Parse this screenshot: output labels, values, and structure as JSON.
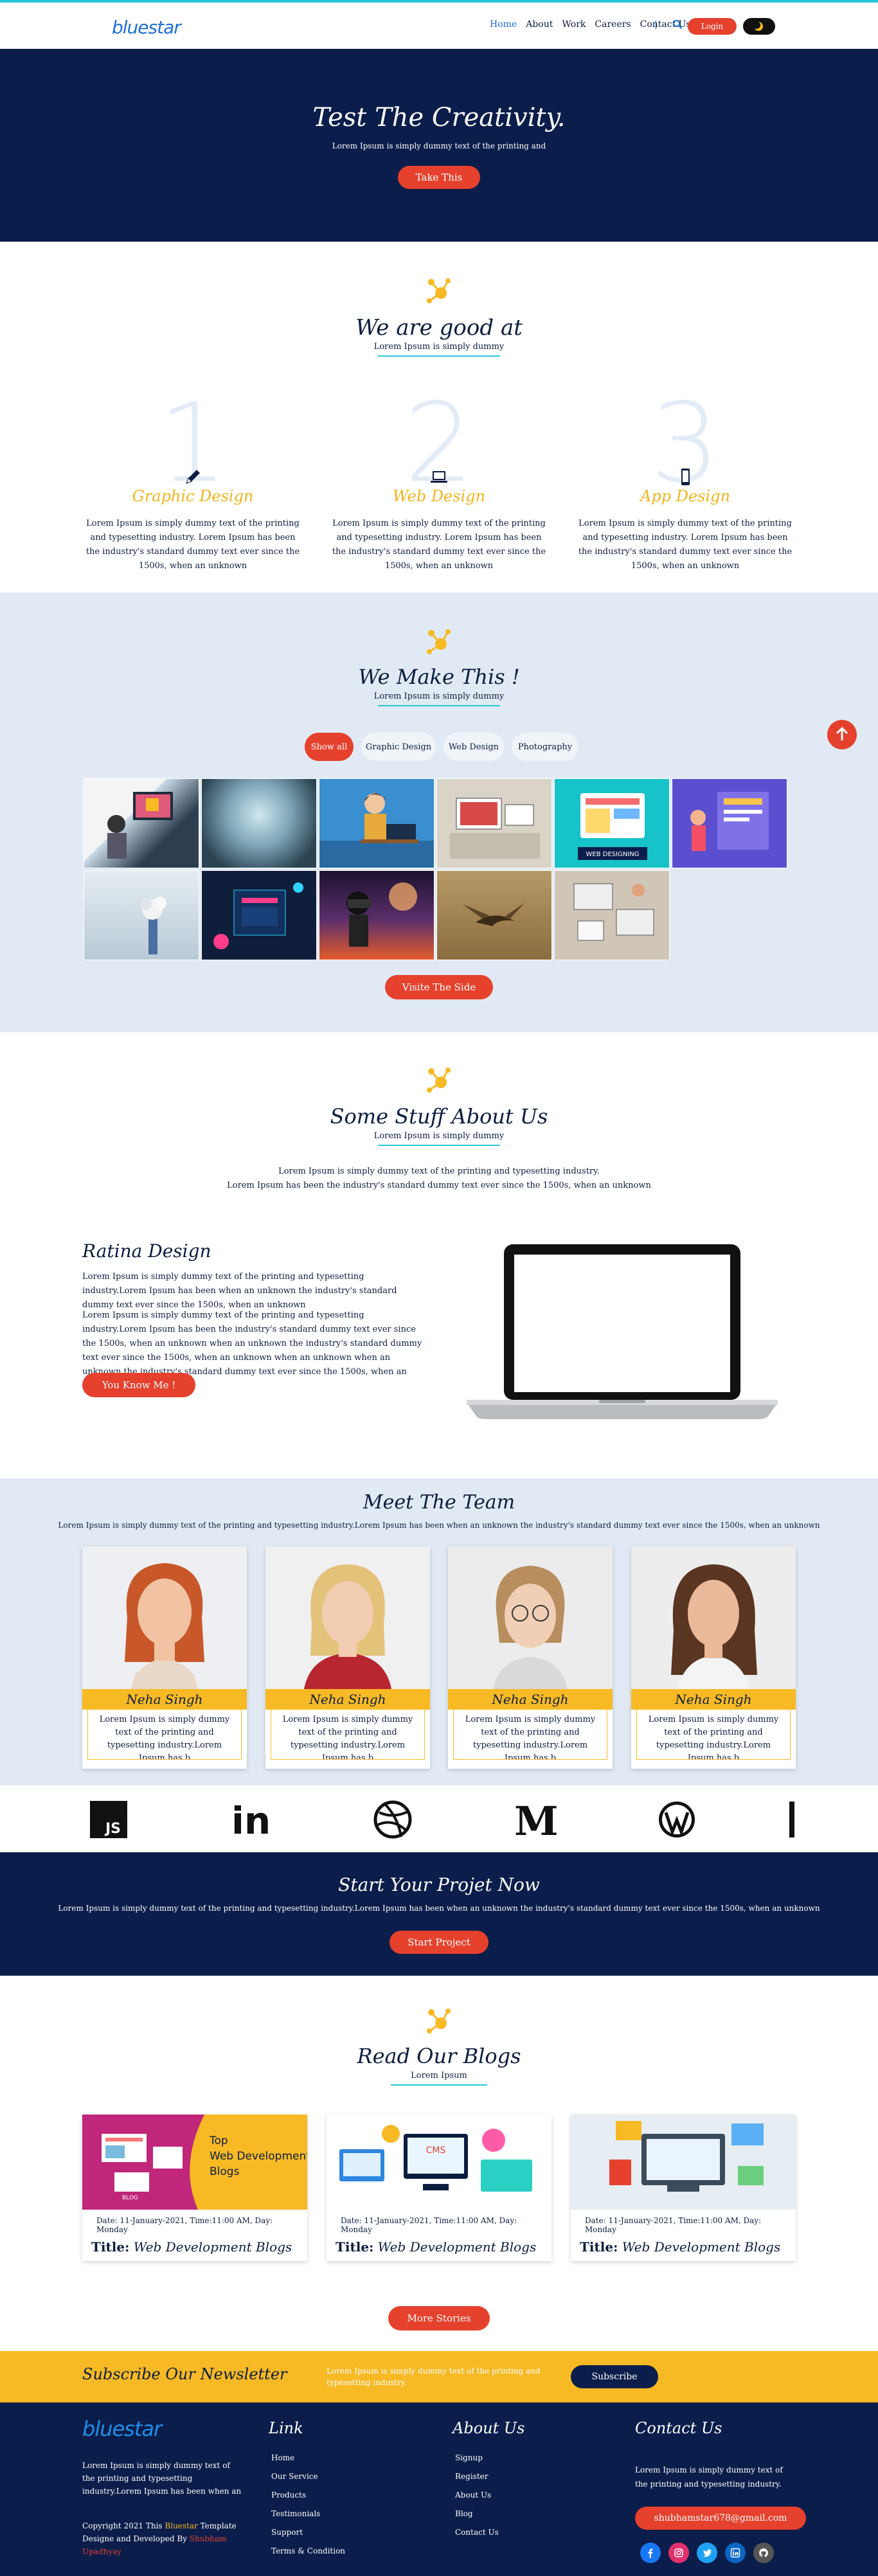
{
  "brand": {
    "logo": "bluestar"
  },
  "nav": {
    "links": [
      "Home",
      "About",
      "Work",
      "Careers",
      "Contact Us"
    ],
    "separator": "|",
    "login": "Login"
  },
  "hero": {
    "title": "Test The Creativity.",
    "subtitle": "Lorem Ipsum is simply dummy text of the printing and",
    "button": "Take This"
  },
  "skills": {
    "title": "We are good at",
    "subtitle": "Lorem Ipsum is simply dummy",
    "items": [
      {
        "num": "1",
        "title": "Graphic Design",
        "icon": "pencil-icon",
        "desc": "Lorem Ipsum is simply dummy text of the printing and typesetting industry. Lorem Ipsum has been the industry's standard dummy text ever since the 1500s, when an unknown"
      },
      {
        "num": "2",
        "title": "Web Design",
        "icon": "laptop-icon",
        "desc": "Lorem Ipsum is simply dummy text of the printing and typesetting industry. Lorem Ipsum has been the industry's standard dummy text ever since the 1500s, when an unknown"
      },
      {
        "num": "3",
        "title": "App Design",
        "icon": "mobile-icon",
        "desc": "Lorem Ipsum is simply dummy text of the printing and typesetting industry. Lorem Ipsum has been the industry's standard dummy text ever since the 1500s, when an unknown"
      }
    ]
  },
  "portfolio": {
    "title": "We Make This !",
    "subtitle": "Lorem Ipsum is simply dummy",
    "filters": [
      "Show all",
      "Graphic Design",
      "Web Design",
      "Photography"
    ],
    "web_designing_label": "WEB DESIGNING",
    "button": "Visite The Side"
  },
  "about": {
    "title": "Some Stuff About Us",
    "subtitle": "Lorem Ipsum is simply dummy",
    "intro1": "Lorem Ipsum is simply dummy text of the printing and typesetting industry.",
    "intro2": "Lorem Ipsum has been the industry's standard dummy text ever since the 1500s, when an unknown",
    "name": "Ratina Design",
    "p1": "Lorem Ipsum is simply dummy text of the printing and typesetting industry.Lorem Ipsum has been when an unknown the industry's standard dummy text ever since the 1500s, when an unknown",
    "p2": "Lorem Ipsum is simply dummy text of the printing and typesetting industry.Lorem Ipsum has been the industry's standard dummy text ever since the 1500s, when an unknown when an unknown the industry's standard dummy text ever since the 1500s, when an unknown when an unknown when an unknown the industry's standard dummy text ever since the 1500s, when an unknown",
    "button": "You Know Me !"
  },
  "team": {
    "title": "Meet The Team",
    "subtitle": "Lorem Ipsum is simply dummy text of the printing and typesetting industry.Lorem Ipsum has been when an unknown the industry's standard dummy text ever since the 1500s, when an unknown",
    "members": [
      {
        "name": "Neha Singh",
        "bio": "Lorem Ipsum is simply dummy text of the printing and typesetting industry.Lorem Ipsum has b"
      },
      {
        "name": "Neha Singh",
        "bio": "Lorem Ipsum is simply dummy text of the printing and typesetting industry.Lorem Ipsum has b"
      },
      {
        "name": "Neha Singh",
        "bio": "Lorem Ipsum is simply dummy text of the printing and typesetting industry.Lorem Ipsum has b"
      },
      {
        "name": "Neha Singh",
        "bio": "Lorem Ipsum is simply dummy text of the printing and typesetting industry.Lorem Ipsum has b"
      }
    ]
  },
  "logos": {
    "js": "JS",
    "linkedin": "in",
    "medium": "M",
    "items": [
      "js-logo-icon",
      "linkedin-logo-icon",
      "dribbble-logo-icon",
      "medium-logo-icon",
      "wordpress-logo-icon"
    ]
  },
  "cta": {
    "title": "Start Your Projet Now",
    "subtitle": "Lorem Ipsum is simply dummy text of the printing and typesetting industry.Lorem Ipsum has been when an unknown the industry's standard dummy text ever since the 1500s, when an unknown",
    "button": "Start Project"
  },
  "blogs": {
    "title": "Read Our Blogs",
    "subtitle": "Lorem Ipsum",
    "banner": {
      "top": "Top",
      "line2": "Web Development",
      "line3": "Blogs",
      "tag": "BLOG"
    },
    "cms_label": "CMS",
    "items": [
      {
        "date": "Date: 11-January-2021, Time:11:00 AM, Day: Monday",
        "title_label": "Title:",
        "title": "Web Development Blogs"
      },
      {
        "date": "Date: 11-January-2021, Time:11:00 AM, Day: Monday",
        "title_label": "Title:",
        "title": "Web Development Blogs"
      },
      {
        "date": "Date: 11-January-2021, Time:11:00 AM, Day: Monday",
        "title_label": "Title:",
        "title": "Web Development Blogs"
      }
    ],
    "button": "More Stories"
  },
  "newsletter": {
    "title": "Subscribe Our Newsletter",
    "text": "Lorem Ipsum is simply dummy text of the printing and typesetting industry.",
    "button": "Subscribe"
  },
  "footer": {
    "about": "Lorem Ipsum is simply dummy text of the printing and typesetting industry.Lorem Ipsum has been when an",
    "copy_pre": "Copyright 2021 This",
    "copy_brand": "Bluestar",
    "copy_mid": "Template Designe and Developed By",
    "copy_author": "Shubham Upadhyay",
    "link_title": "Link",
    "links": [
      "Home",
      "Our Service",
      "Products",
      "Testimonials",
      "Support",
      "Terms & Condition"
    ],
    "about_title": "About Us",
    "about_links": [
      "Signup",
      "Register",
      "About Us",
      "Blog",
      "Contact Us"
    ],
    "contact_title": "Contact Us",
    "contact_text": "Lorem Ipsum is simply dummy text of the printing and typesetting industry.",
    "email": "shubhamstar678@gmail.com",
    "social": [
      "facebook-icon",
      "instagram-icon",
      "twitter-icon",
      "linkedin-icon",
      "github-icon"
    ],
    "social_colors": [
      "#1877f2",
      "#e1306c",
      "#1da1f2",
      "#0a66c2",
      "#555555"
    ]
  },
  "colors": {
    "navy": "#0b1d4a",
    "accent_red": "#e5412d",
    "accent_yellow": "#f7b924",
    "link_blue": "#1e6fd9",
    "light_bg": "#e1eaf4"
  }
}
